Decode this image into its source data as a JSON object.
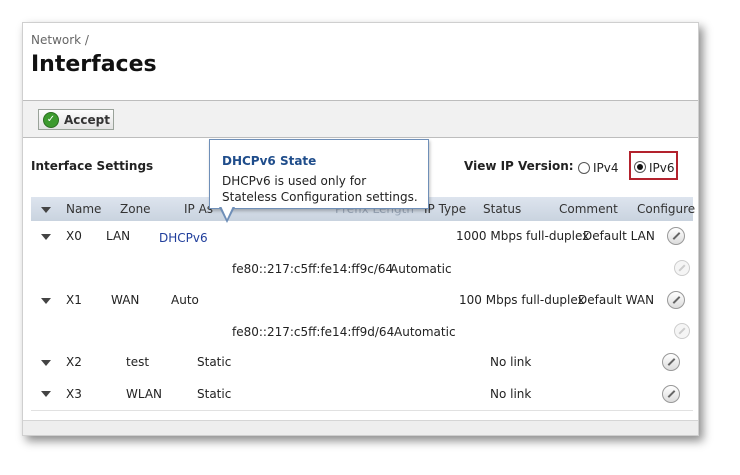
{
  "breadcrumb": "Network /",
  "page_title": "Interfaces",
  "toolbar": {
    "accept_label": "Accept"
  },
  "section_title": "Interface Settings",
  "view_ip": {
    "label": "View IP Version:",
    "options": [
      "IPv4",
      "IPv6"
    ],
    "selected": "IPv6"
  },
  "table": {
    "columns": [
      "Name",
      "Zone",
      "IP As",
      "Prefix Length",
      "IP Type",
      "Status",
      "Comment",
      "Configure"
    ],
    "rows": [
      {
        "name": "X0",
        "zone": "LAN",
        "ip": "DHCPv6",
        "status": "1000 Mbps full-duplex",
        "comment": "Default LAN",
        "sub": {
          "address": "fe80::217:c5ff:fe14:ff9c/64",
          "type": "Automatic"
        }
      },
      {
        "name": "X1",
        "zone": "WAN",
        "ip": "Auto",
        "status": "100 Mbps full-duplex",
        "comment": "Default WAN",
        "sub": {
          "address": "fe80::217:c5ff:fe14:ff9d/64",
          "type": "Automatic"
        }
      },
      {
        "name": "X2",
        "zone": "test",
        "ip": "Static",
        "status": "No link",
        "comment": ""
      },
      {
        "name": "X3",
        "zone": "WLAN",
        "ip": "Static",
        "status": "No link",
        "comment": ""
      }
    ]
  },
  "tooltip": {
    "title": "DHCPv6 State",
    "body": "DHCPv6 is used only for Stateless Configuration settings."
  },
  "colors": {
    "accent_red": "#b3222d",
    "link_blue": "#1f3d9b",
    "header_bg": "#c9d3df"
  }
}
